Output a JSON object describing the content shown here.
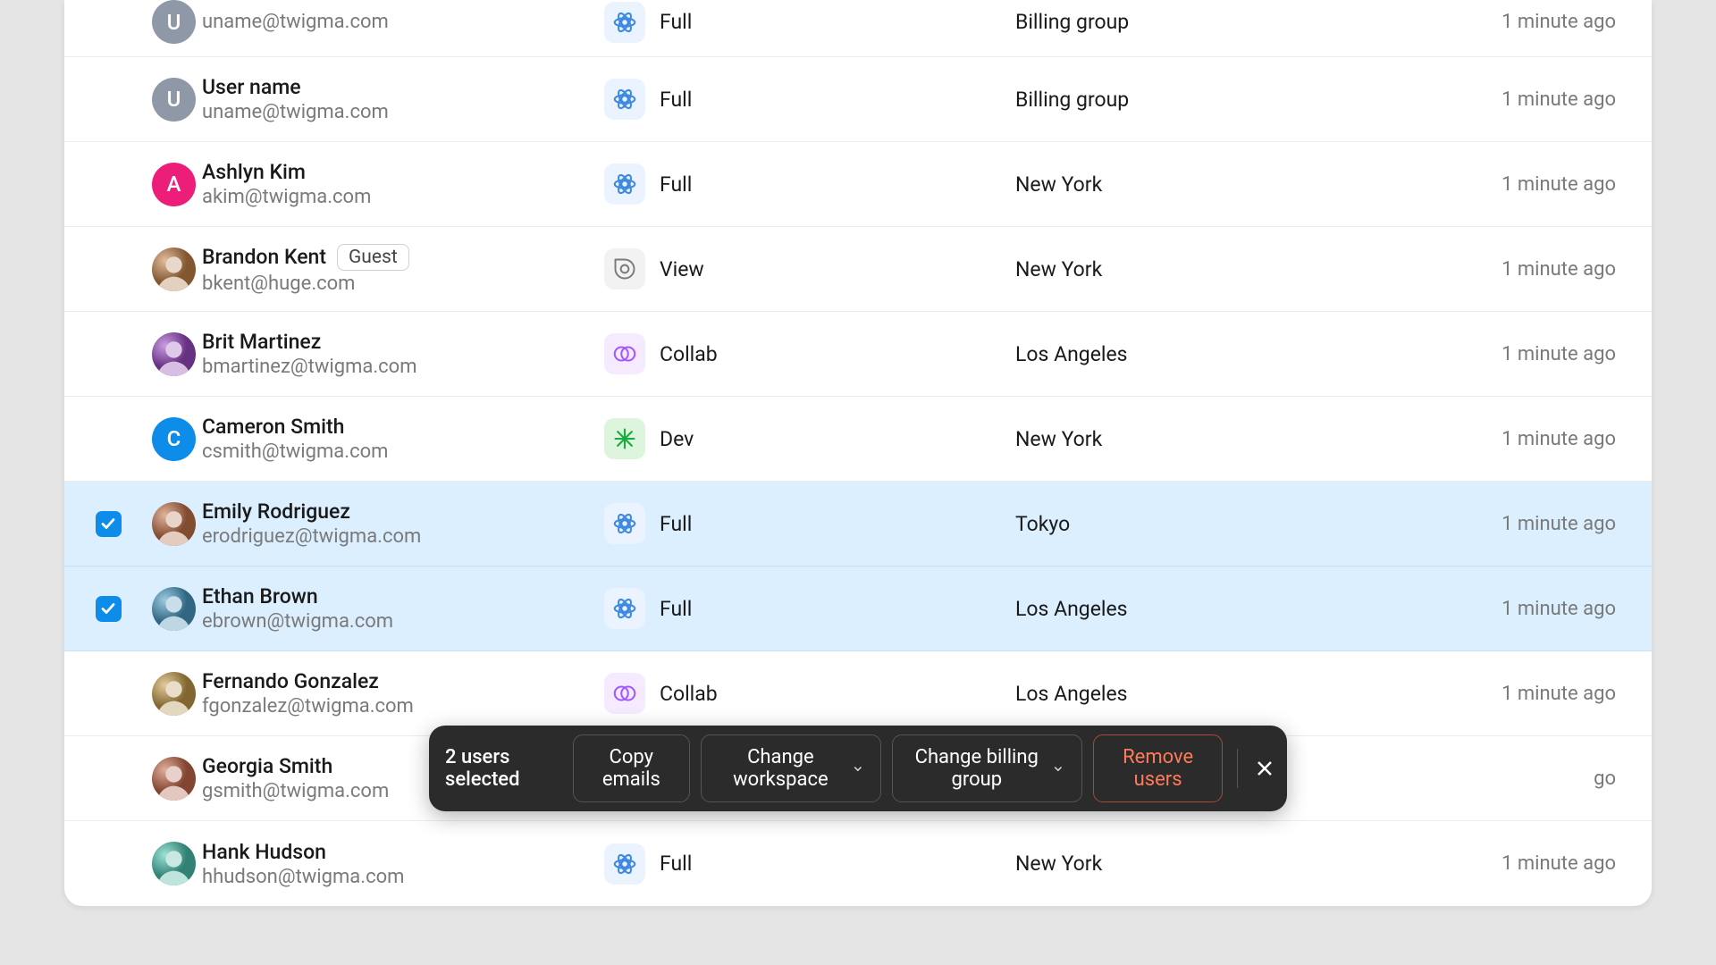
{
  "users": [
    {
      "name": "",
      "email": "uname@twigma.com",
      "avatar": {
        "type": "initial",
        "letter": "U",
        "bg": "#8f98a6"
      },
      "seat": "Full",
      "group": "Billing group",
      "time": "1 minute ago",
      "selected": false,
      "badge": null,
      "partial": true
    },
    {
      "name": "User name",
      "email": "uname@twigma.com",
      "avatar": {
        "type": "initial",
        "letter": "U",
        "bg": "#8f98a6"
      },
      "seat": "Full",
      "group": "Billing group",
      "time": "1 minute ago",
      "selected": false,
      "badge": null
    },
    {
      "name": "Ashlyn Kim",
      "email": "akim@twigma.com",
      "avatar": {
        "type": "initial",
        "letter": "A",
        "bg": "#ec1e79"
      },
      "seat": "Full",
      "group": "New York",
      "time": "1 minute ago",
      "selected": false,
      "badge": null
    },
    {
      "name": "Brandon Kent",
      "email": "bkent@huge.com",
      "avatar": {
        "type": "photo",
        "seed": 1
      },
      "seat": "View",
      "group": "New York",
      "time": "1 minute ago",
      "selected": false,
      "badge": "Guest"
    },
    {
      "name": "Brit Martinez",
      "email": "bmartinez@twigma.com",
      "avatar": {
        "type": "photo",
        "seed": 2
      },
      "seat": "Collab",
      "group": "Los Angeles",
      "time": "1 minute ago",
      "selected": false,
      "badge": null
    },
    {
      "name": "Cameron Smith",
      "email": "csmith@twigma.com",
      "avatar": {
        "type": "initial",
        "letter": "C",
        "bg": "#0d8ce9"
      },
      "seat": "Dev",
      "group": "New York",
      "time": "1 minute ago",
      "selected": false,
      "badge": null
    },
    {
      "name": "Emily Rodriguez",
      "email": "erodriguez@twigma.com",
      "avatar": {
        "type": "photo",
        "seed": 3
      },
      "seat": "Full",
      "group": "Tokyo",
      "time": "1 minute ago",
      "selected": true,
      "badge": null
    },
    {
      "name": "Ethan Brown",
      "email": "ebrown@twigma.com",
      "avatar": {
        "type": "photo",
        "seed": 4
      },
      "seat": "Full",
      "group": "Los Angeles",
      "time": "1 minute ago",
      "selected": true,
      "badge": null
    },
    {
      "name": "Fernando Gonzalez",
      "email": "fgonzalez@twigma.com",
      "avatar": {
        "type": "photo",
        "seed": 5
      },
      "seat": "Collab",
      "group": "Los Angeles",
      "time": "1 minute ago",
      "selected": false,
      "badge": null
    },
    {
      "name": "Georgia Smith",
      "email": "gsmith@twigma.com",
      "avatar": {
        "type": "photo",
        "seed": 6
      },
      "seat": "",
      "group": "",
      "time": "go",
      "selected": false,
      "badge": null,
      "obscured": true
    },
    {
      "name": "Hank Hudson",
      "email": "hhudson@twigma.com",
      "avatar": {
        "type": "photo",
        "seed": 7
      },
      "seat": "Full",
      "group": "New York",
      "time": "1 minute ago",
      "selected": false,
      "badge": null
    }
  ],
  "actionbar": {
    "count_label": "2 users selected",
    "copy_emails": "Copy emails",
    "change_workspace": "Change workspace",
    "change_billing": "Change billing group",
    "remove_users": "Remove users"
  },
  "seat_meta": {
    "Full": {
      "class": "seat-full"
    },
    "View": {
      "class": "seat-view"
    },
    "Collab": {
      "class": "seat-collab"
    },
    "Dev": {
      "class": "seat-dev"
    }
  }
}
